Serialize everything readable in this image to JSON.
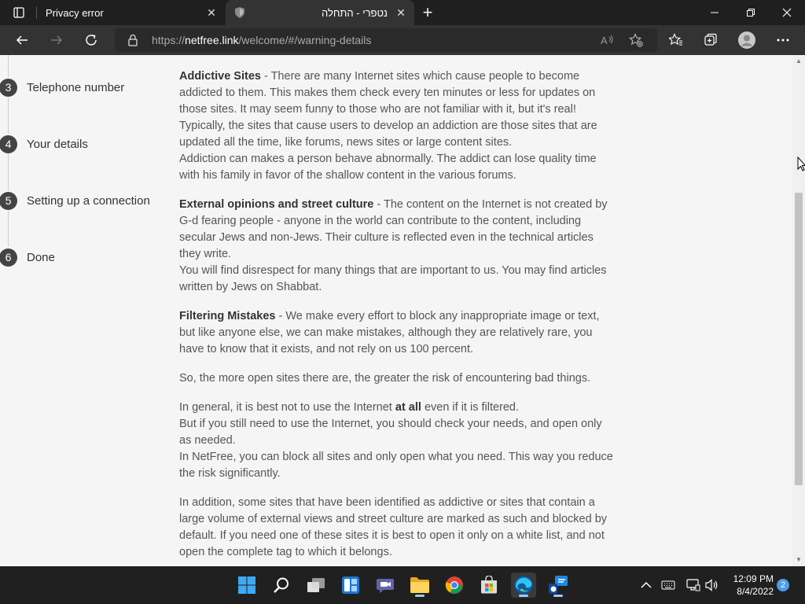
{
  "browser": {
    "tabs": [
      {
        "title": "Privacy error",
        "active": false
      },
      {
        "title": "נטפרי - התחלה",
        "active": true
      }
    ],
    "url_prefix": "https://",
    "url_domain": "netfree.link",
    "url_path": "/welcome/#/warning-details"
  },
  "steps": [
    {
      "num": "3",
      "label": "Telephone number"
    },
    {
      "num": "4",
      "label": "Your details"
    },
    {
      "num": "5",
      "label": "Setting up a connection"
    },
    {
      "num": "6",
      "label": "Done"
    }
  ],
  "article": {
    "p1": {
      "heading": "Addictive Sites",
      "text": " - There are many Internet sites which cause people to become addicted to them. This makes them check every ten minutes or less for updates on those sites. It may seem funny to those who are not familiar with it, but it's real! Typically, the sites that cause users to develop an addiction are those sites that are updated all the time, like forums, news sites or large content sites.",
      "text2": "Addiction can makes a person behave abnormally. The addict can lose quality time with his family in favor of the shallow content in the various forums."
    },
    "p2": {
      "heading": "External opinions and street culture",
      "text": " - The content on the Internet is not created by G-d fearing people - anyone in the world can contribute to the content, including secular Jews and non-Jews. Their culture is reflected even in the technical articles they write.",
      "text2": "You will find disrespect for many things that are important to us. You may find articles written by Jews on Shabbat."
    },
    "p3": {
      "heading": "Filtering Mistakes",
      "text": " - We make every effort to block any inappropriate image or text, but like anyone else, we can make mistakes, although they are relatively rare, you have to know that it exists, and not rely on us 100 percent."
    },
    "p4": "So, the more open sites there are, the greater the risk of encountering bad things.",
    "p5": {
      "a": "In general, it is best not to use the Internet ",
      "bold": "at all",
      "b": " even if it is filtered.",
      "line2": "But if you still need to use the Internet, you should check your needs, and open only as needed.",
      "line3": "In NetFree, you can block all sites and only open what you need. This way you reduce the risk significantly."
    },
    "p6": "In addition, some sites that have been identified as addictive or sites that contain a large volume of external views and street culture are marked as such and blocked by default. If you need one of these sites it is best to open it only on a white list, and not open the complete tag to which it belongs."
  },
  "taskbar": {
    "time": "12:09 PM",
    "date": "8/4/2022",
    "notifications": "2"
  }
}
